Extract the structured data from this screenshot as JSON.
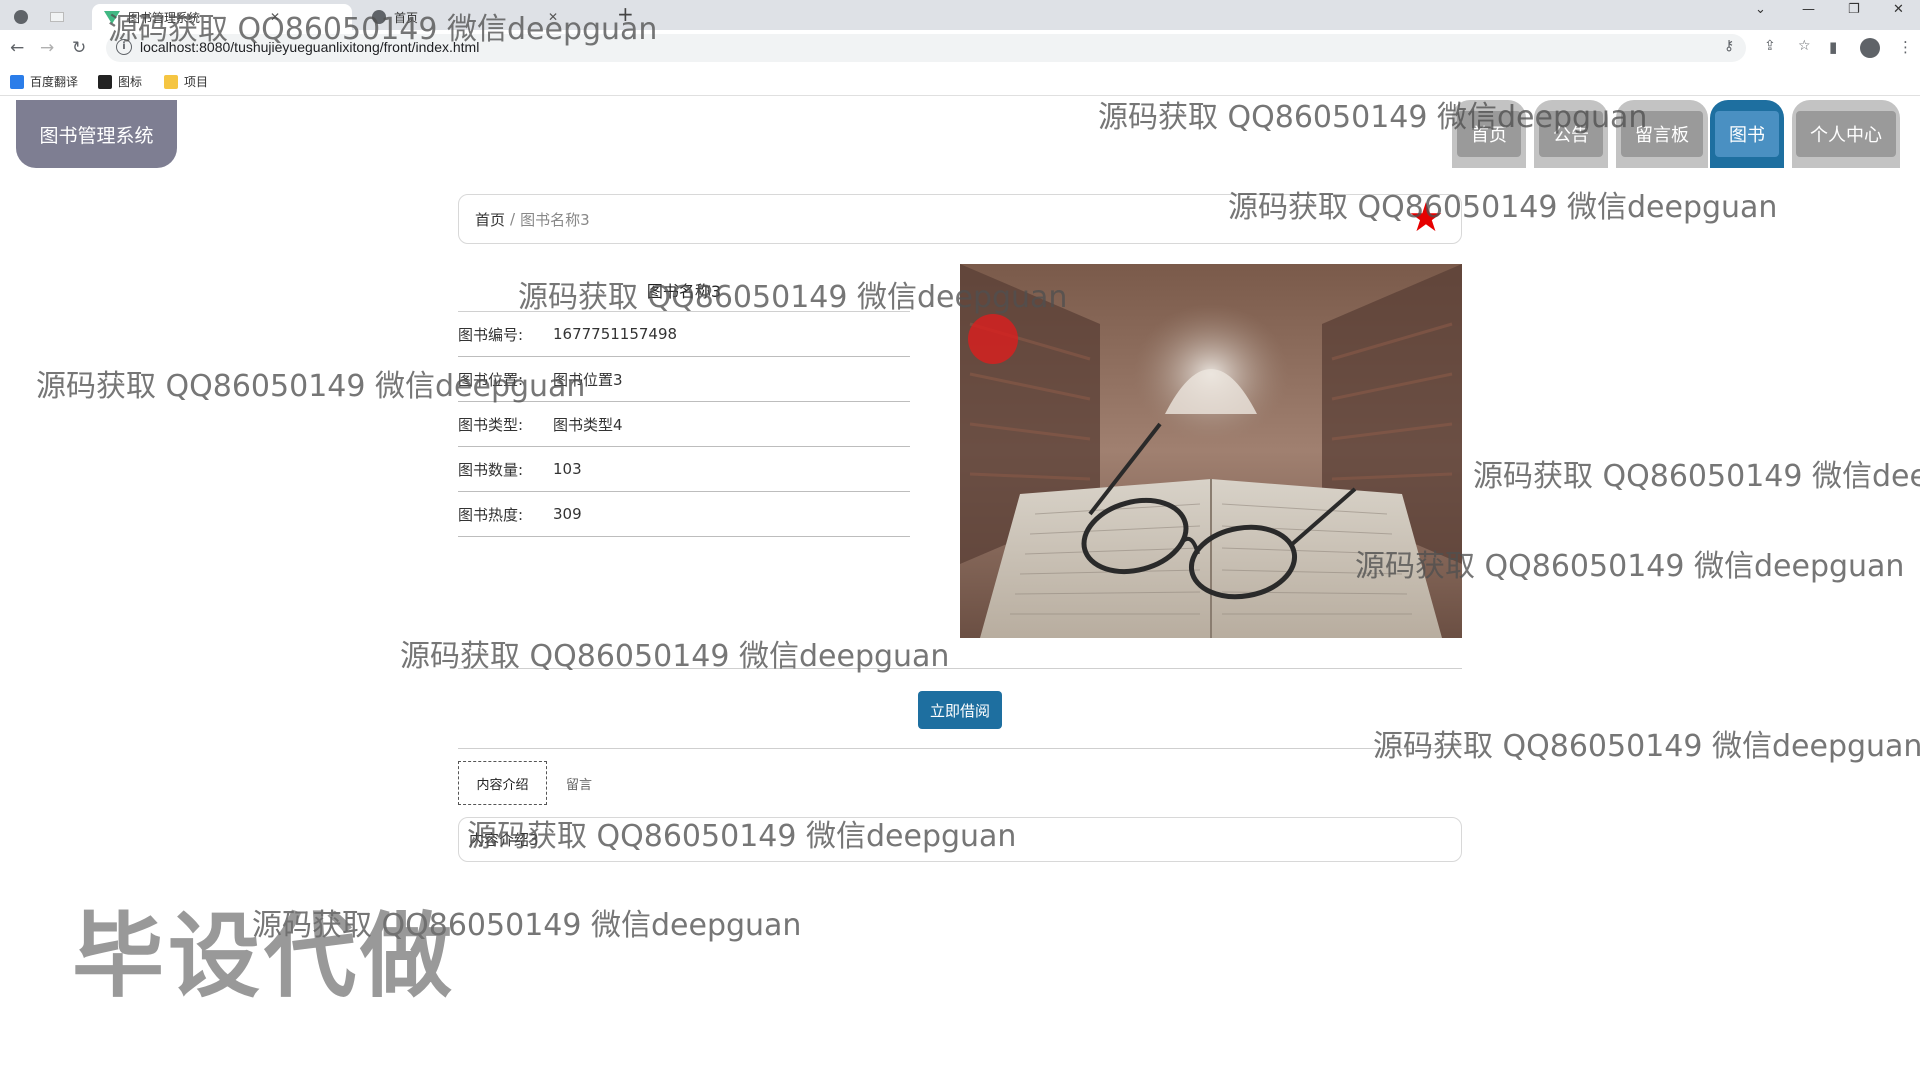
{
  "browser": {
    "tabs": [
      {
        "label": ""
      },
      {
        "label": "图书管理系统"
      },
      {
        "label": "首页"
      }
    ],
    "new_tab": "+",
    "url": "localhost:8080/tushujieyueguanlixitong/front/index.html",
    "bookmarks": [
      {
        "label": "百度翻译"
      },
      {
        "label": "图标"
      },
      {
        "label": "项目"
      }
    ]
  },
  "site": {
    "logo": "图书管理系统",
    "nav": [
      {
        "label": "首页"
      },
      {
        "label": "公告"
      },
      {
        "label": "留言板"
      },
      {
        "label": "图书",
        "active": true
      },
      {
        "label": "个人中心"
      }
    ]
  },
  "breadcrumb": {
    "home": "首页",
    "separator": "/",
    "current": "图书名称3"
  },
  "favorite_icon": "star-icon",
  "book": {
    "title": "图书名称3",
    "fields": [
      {
        "label": "图书编号:",
        "value": "1677751157498"
      },
      {
        "label": "图书位置:",
        "value": "图书位置3"
      },
      {
        "label": "图书类型:",
        "value": "图书类型4"
      },
      {
        "label": "图书数量:",
        "value": "103"
      },
      {
        "label": "图书热度:",
        "value": "309"
      }
    ],
    "borrow_button": "立即借阅"
  },
  "detail_tabs": [
    {
      "label": "内容介绍",
      "active": true
    },
    {
      "label": "留言"
    }
  ],
  "content": "内容介绍3",
  "watermarks": [
    "源码获取 QQ86050149 微信deepguan",
    "源码获取 QQ86050149 微信deepguan",
    "源码获取 QQ86050149 微信deepguan",
    "源码获取 QQ86050149 微信deepguan",
    "源码获取 QQ86050149 微信deepguan",
    "源码获取 QQ86050149 微信deep",
    "源码获取 QQ86050149 微信deepguan",
    "源码获取 QQ86050149 微信deepguan",
    "源码获取 QQ86050149 微信deepguan",
    "源码获取 QQ86050149 微信deepguan",
    "源码获取 QQ86050149 微信deepguan"
  ],
  "stamp": "毕设代做",
  "colors": {
    "logo_bg": "#7e7e92",
    "nav_active": "#1e6fa0",
    "button": "#1e6fa0",
    "star": "#e60000"
  }
}
